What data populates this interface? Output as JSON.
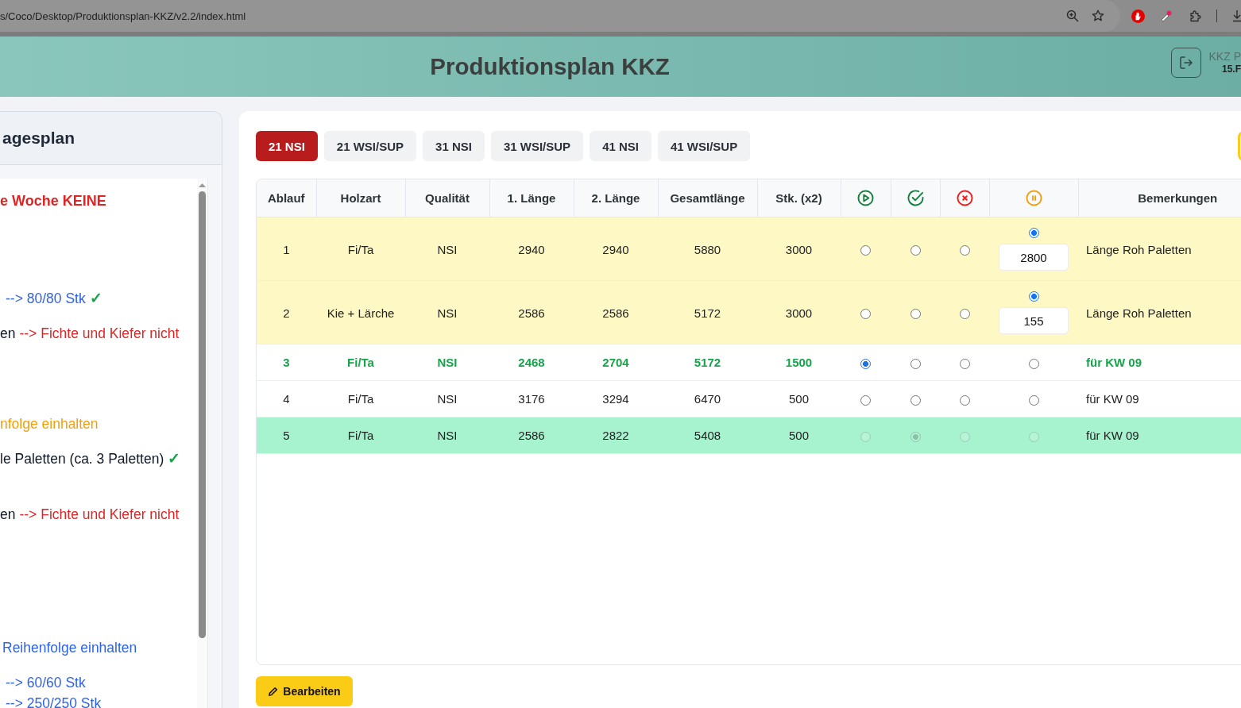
{
  "browser": {
    "address": "s/Coco/Desktop/Produktionsplan-KKZ/v2.2/index.html"
  },
  "header": {
    "title": "Produktionsplan KKZ",
    "user_name": "KKZ P",
    "user_detail": "15.F"
  },
  "sidebar": {
    "title": "agesplan",
    "lines": [
      {
        "bold": true,
        "segments": [
          {
            "kind": "text",
            "text": "e Woche KEINE",
            "color": "#dc2626"
          }
        ]
      },
      {
        "bold": false,
        "segments": [
          {
            "kind": "text",
            "text": "--> 80/80 Stk",
            "color": "#2f63e6"
          },
          {
            "kind": "check",
            "text": "✓",
            "color": "#16a34a"
          }
        ]
      },
      {
        "bold": false,
        "segments": [
          {
            "kind": "text",
            "text": "en",
            "color": "#111827"
          },
          {
            "kind": "text",
            "text": "--> Fichte und Kiefer nicht",
            "color": "#dc2626"
          }
        ]
      },
      {
        "bold": false,
        "segments": [
          {
            "kind": "text",
            "text": "nfolge einhalten",
            "color": "#f59e0b"
          }
        ]
      },
      {
        "bold": false,
        "segments": [
          {
            "kind": "text",
            "text": "le Paletten (ca. 3 Paletten)",
            "color": "#111827"
          },
          {
            "kind": "check",
            "text": "✓",
            "color": "#16a34a"
          }
        ]
      },
      {
        "bold": false,
        "segments": [
          {
            "kind": "text",
            "text": "en",
            "color": "#111827"
          },
          {
            "kind": "text",
            "text": "--> Fichte und Kiefer nicht",
            "color": "#dc2626"
          }
        ]
      },
      {
        "bold": false,
        "segments": [
          {
            "kind": "text",
            "text": "Reihenfolge einhalten",
            "color": "#2f63e6"
          }
        ]
      },
      {
        "bold": false,
        "segments": [
          {
            "kind": "text",
            "text": "--> 60/60 Stk",
            "color": "#2f63e6"
          }
        ]
      },
      {
        "bold": false,
        "segments": [
          {
            "kind": "text",
            "text": "--> 250/250 Stk",
            "color": "#2f63e6"
          }
        ]
      }
    ]
  },
  "tabs": [
    {
      "label": "21 NSI",
      "selected": true
    },
    {
      "label": "21 WSI/SUP",
      "selected": false
    },
    {
      "label": "31 NSI",
      "selected": false
    },
    {
      "label": "31 WSI/SUP",
      "selected": false
    },
    {
      "label": "41 NSI",
      "selected": false
    },
    {
      "label": "41 WSI/SUP",
      "selected": false
    }
  ],
  "table": {
    "columns": [
      {
        "kind": "text",
        "label": "Ablauf"
      },
      {
        "kind": "text",
        "label": "Holzart"
      },
      {
        "kind": "text",
        "label": "Qualität"
      },
      {
        "kind": "text",
        "label": "1. Länge"
      },
      {
        "kind": "text",
        "label": "2. Länge"
      },
      {
        "kind": "text",
        "label": "Gesamtlänge"
      },
      {
        "kind": "text",
        "label": "Stk. (x2)"
      },
      {
        "kind": "status"
      },
      {
        "kind": "status"
      },
      {
        "kind": "status"
      },
      {
        "kind": "status"
      },
      {
        "kind": "text",
        "label": "Bemerkungen"
      }
    ],
    "rows": [
      {
        "kind": "paused",
        "disabled": false,
        "cells": [
          "1",
          "Fi/Ta",
          "NSI",
          "2940",
          "2940",
          "5880",
          "3000"
        ],
        "choices": [
          {
            "selected": false
          },
          {
            "selected": false
          },
          {
            "selected": false
          },
          {
            "selected": true
          }
        ],
        "pause_input": "2800",
        "remark": "Länge Roh Paletten"
      },
      {
        "kind": "paused",
        "disabled": false,
        "cells": [
          "2",
          "Kie + Lärche",
          "NSI",
          "2586",
          "2586",
          "5172",
          "3000"
        ],
        "choices": [
          {
            "selected": false
          },
          {
            "selected": false
          },
          {
            "selected": false
          },
          {
            "selected": true
          }
        ],
        "pause_input": "155",
        "remark": "Länge Roh Paletten"
      },
      {
        "kind": "running",
        "disabled": false,
        "cells": [
          "3",
          "Fi/Ta",
          "NSI",
          "2468",
          "2704",
          "5172",
          "1500"
        ],
        "choices": [
          {
            "selected": true
          },
          {
            "selected": false
          },
          {
            "selected": false
          },
          {
            "selected": false
          }
        ],
        "remark": "für KW 09"
      },
      {
        "kind": "open",
        "disabled": false,
        "cells": [
          "4",
          "Fi/Ta",
          "NSI",
          "3176",
          "3294",
          "6470",
          "500"
        ],
        "choices": [
          {
            "selected": false
          },
          {
            "selected": false
          },
          {
            "selected": false
          },
          {
            "selected": false
          }
        ],
        "remark": "für KW 09"
      },
      {
        "kind": "done",
        "disabled": true,
        "cells": [
          "5",
          "Fi/Ta",
          "NSI",
          "2586",
          "2822",
          "5408",
          "500"
        ],
        "choices": [
          {
            "selected": false
          },
          {
            "selected": true
          },
          {
            "selected": false
          },
          {
            "selected": false
          }
        ],
        "remark": "für KW 09"
      }
    ]
  },
  "edit_button": {
    "label": "Bearbeiten"
  }
}
